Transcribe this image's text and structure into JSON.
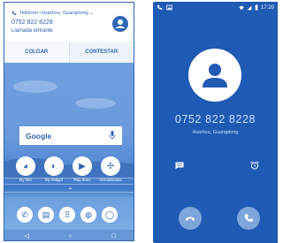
{
  "left_screen": {
    "incoming_card": {
      "header": "Teléfono • Huizhou, Guangdong ⌄",
      "number": "0752 822 8228",
      "status": "Llamada entrante",
      "decline_label": "COLGAR",
      "answer_label": "CONTESTAR"
    },
    "search": {
      "logo": "Google"
    },
    "apps": [
      {
        "label": "My files",
        "icon": "folder-globe-icon"
      },
      {
        "label": "My Widget",
        "icon": "widget-icon"
      },
      {
        "label": "Play Store",
        "icon": "play-store-icon"
      },
      {
        "label": "Herramientas",
        "icon": "tools-icon"
      }
    ],
    "dock": [
      {
        "icon": "phone-icon"
      },
      {
        "icon": "messages-icon"
      },
      {
        "icon": "app-drawer-icon"
      },
      {
        "icon": "chrome-icon"
      },
      {
        "icon": "camera-icon"
      }
    ],
    "nav": [
      "◁",
      "○",
      "□"
    ]
  },
  "right_screen": {
    "status_time": "17:20",
    "phone_number": "0752 822 8228",
    "location": "Huizhou, Guangdong"
  },
  "colors": {
    "accent": "#2f66b3",
    "dark_bg": "#1f5ab4",
    "light_text": "#cfe0f7"
  }
}
